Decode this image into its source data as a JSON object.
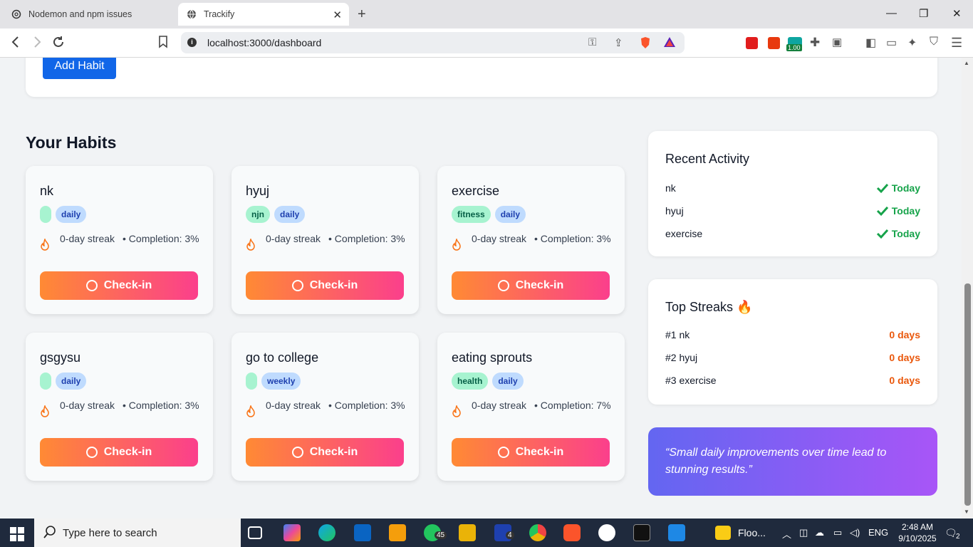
{
  "browser": {
    "tabs": [
      {
        "title": "Nodemon and npm issues",
        "active": false
      },
      {
        "title": "Trackify",
        "active": true
      }
    ],
    "url": "localhost:3000/dashboard",
    "extension_badge": "1.00"
  },
  "page": {
    "add_habit_label": "Add Habit",
    "habits_title": "Your Habits",
    "habits": [
      {
        "name": "nk",
        "category": "",
        "frequency": "daily",
        "streak": "0-day streak",
        "completion": "• Completion: 3%",
        "action": "Check-in"
      },
      {
        "name": "hyuj",
        "category": "njn",
        "frequency": "daily",
        "streak": "0-day streak",
        "completion": "• Completion: 3%",
        "action": "Check-in"
      },
      {
        "name": "exercise",
        "category": "fitness",
        "frequency": "daily",
        "streak": "0-day streak",
        "completion": "• Completion: 3%",
        "action": "Check-in"
      },
      {
        "name": "gsgysu",
        "category": "",
        "frequency": "daily",
        "streak": "0-day streak",
        "completion": "• Completion: 3%",
        "action": "Check-in"
      },
      {
        "name": "go to college",
        "category": "",
        "frequency": "weekly",
        "streak": "0-day streak",
        "completion": "• Completion: 3%",
        "action": "Check-in"
      },
      {
        "name": "eating sprouts",
        "category": "health",
        "frequency": "daily",
        "streak": "0-day streak",
        "completion": "• Completion: 7%",
        "action": "Check-in"
      }
    ],
    "recent_activity": {
      "title": "Recent Activity",
      "items": [
        {
          "name": "nk",
          "status": "Today"
        },
        {
          "name": "hyuj",
          "status": "Today"
        },
        {
          "name": "exercise",
          "status": "Today"
        }
      ]
    },
    "top_streaks": {
      "title": "Top Streaks 🔥",
      "items": [
        {
          "rank": "#1 nk",
          "value": "0 days"
        },
        {
          "rank": "#2 hyuj",
          "value": "0 days"
        },
        {
          "rank": "#3 exercise",
          "value": "0 days"
        }
      ]
    },
    "quote": "“Small daily improvements over time lead to stunning results.”"
  },
  "taskbar": {
    "search_placeholder": "Type here to search",
    "whatsapp_badge": "45",
    "l_badge": "4",
    "pinned_label": "Floo...",
    "language": "ENG",
    "time": "2:48 AM",
    "date": "9/10/2025",
    "notifications": "2"
  },
  "colors": {
    "accent": "#1166e8",
    "checkin_gradient": [
      "#ff8a34",
      "#fb3f8c"
    ],
    "quote_gradient": [
      "#6366f1",
      "#a855f7"
    ],
    "status_green": "#16a34a",
    "streak_orange": "#ea580c"
  }
}
